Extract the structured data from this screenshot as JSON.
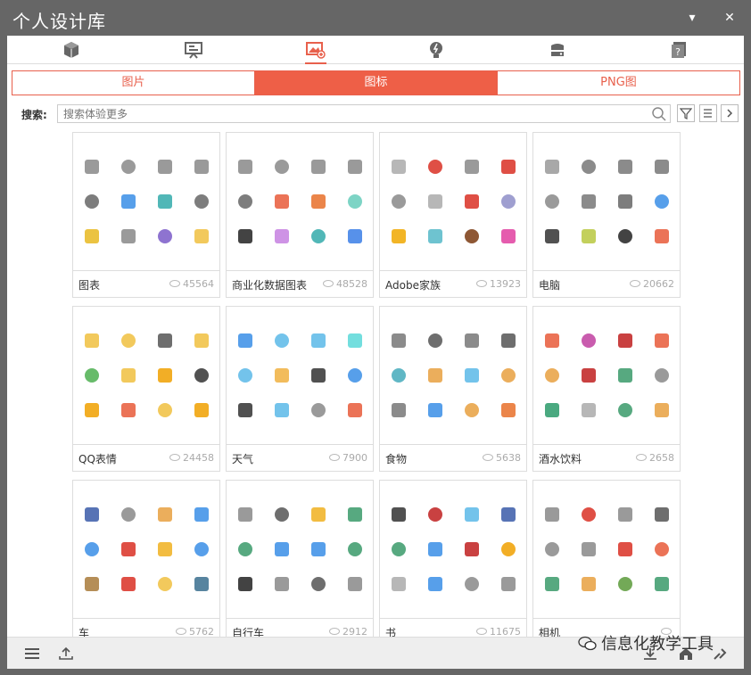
{
  "window": {
    "title": "个人设计库",
    "menu_glyph": "▾",
    "close_glyph": "✕"
  },
  "top_tabs": [
    {
      "icon": "cube-icon"
    },
    {
      "icon": "presentation-icon"
    },
    {
      "icon": "image-library-icon",
      "active": true
    },
    {
      "icon": "lightbulb-icon"
    },
    {
      "icon": "storage-icon"
    },
    {
      "icon": "help-icon"
    }
  ],
  "sub_tabs": [
    {
      "label": "图片",
      "active": false
    },
    {
      "label": "图标",
      "active": true
    },
    {
      "label": "PNG图",
      "active": false
    }
  ],
  "search": {
    "label": "搜索:",
    "placeholder": "搜索体验更多"
  },
  "accent_color": "#ee5f47",
  "cards": [
    {
      "name": "图表",
      "count": "45564",
      "colors": [
        "#888",
        "#888",
        "#888",
        "#888",
        "#666",
        "#3a8ee6",
        "#3aa",
        "#666",
        "#e8b820",
        "#888",
        "#7a5ac8",
        "#f0c040"
      ]
    },
    {
      "name": "商业化数据图表",
      "count": "48528",
      "colors": [
        "#888",
        "#888",
        "#888",
        "#888",
        "#666",
        "#e85a3a",
        "#e8702a",
        "#6cb",
        "#222",
        "#c580e0",
        "#3aa",
        "#3a7ee6"
      ]
    },
    {
      "name": "Adobe家族",
      "count": "13923",
      "colors": [
        "#aaa",
        "#d93025",
        "#888",
        "#d93025",
        "#888",
        "#aaa",
        "#d93025",
        "#8e8ec8",
        "#f0a800",
        "#55b8c8",
        "#7a3a10",
        "#e040a0"
      ]
    },
    {
      "name": "电脑",
      "count": "20662",
      "colors": [
        "#999",
        "#777",
        "#777",
        "#777",
        "#888",
        "#777",
        "#666",
        "#3a8ee6",
        "#333",
        "#b8c840",
        "#222",
        "#e85a3a"
      ]
    },
    {
      "name": "QQ表情",
      "count": "24458",
      "colors": [
        "#f0c040",
        "#f0c040",
        "#555",
        "#f0c040",
        "#4caf50",
        "#f0c040",
        "#f0a000",
        "#333",
        "#f0a000",
        "#e85a3a",
        "#f0c040",
        "#f0a000"
      ]
    },
    {
      "name": "天气",
      "count": "7900",
      "colors": [
        "#3a8ee6",
        "#5ab8e8",
        "#5ab8e8",
        "#5ad8d8",
        "#5ab8e8",
        "#f0b040",
        "#333",
        "#3a8ee6",
        "#333",
        "#5ab8e8",
        "#888",
        "#e85a3a"
      ]
    },
    {
      "name": "食物",
      "count": "5638",
      "colors": [
        "#777",
        "#555",
        "#777",
        "#555",
        "#4ab",
        "#e8a040",
        "#5ab8e8",
        "#e8a040",
        "#777",
        "#3a8ee6",
        "#e8a040",
        "#e8702a"
      ]
    },
    {
      "name": "酒水饮料",
      "count": "2658",
      "colors": [
        "#e85a3a",
        "#c040a0",
        "#c02020",
        "#e85a3a",
        "#e8a040",
        "#c02020",
        "#3a9a6a",
        "#888",
        "#2a9a6a",
        "#aaa",
        "#3a9a6a",
        "#e8a040"
      ]
    },
    {
      "name": "车",
      "count": "5762",
      "colors": [
        "#3a5aa8",
        "#888",
        "#e8a040",
        "#3a8ee6",
        "#3a8ee6",
        "#d93025",
        "#f0b020",
        "#3a8ee6",
        "#a87a3a",
        "#d93025",
        "#f0c040",
        "#3a6e8e"
      ]
    },
    {
      "name": "自行车",
      "count": "2912",
      "colors": [
        "#888",
        "#555",
        "#f0b020",
        "#3a9a6a",
        "#3a9a6a",
        "#3a8ee6",
        "#3a8ee6",
        "#3a9a6a",
        "#222",
        "#888",
        "#555",
        "#888"
      ]
    },
    {
      "name": "书",
      "count": "11675",
      "colors": [
        "#333",
        "#c02020",
        "#5ab8e8",
        "#3a5aa8",
        "#3a9a6a",
        "#3a8ee6",
        "#c02020",
        "#f0a000",
        "#aaa",
        "#3a8ee6",
        "#888",
        "#888"
      ]
    },
    {
      "name": "相机",
      "count": "",
      "colors": [
        "#888",
        "#d93025",
        "#888",
        "#555",
        "#888",
        "#888",
        "#d93025",
        "#e85a3a",
        "#3a9a6a",
        "#e8a040",
        "#5a9a3a",
        "#3a9a6a"
      ]
    }
  ],
  "bottom": {
    "watermark": "信息化教学工具"
  }
}
